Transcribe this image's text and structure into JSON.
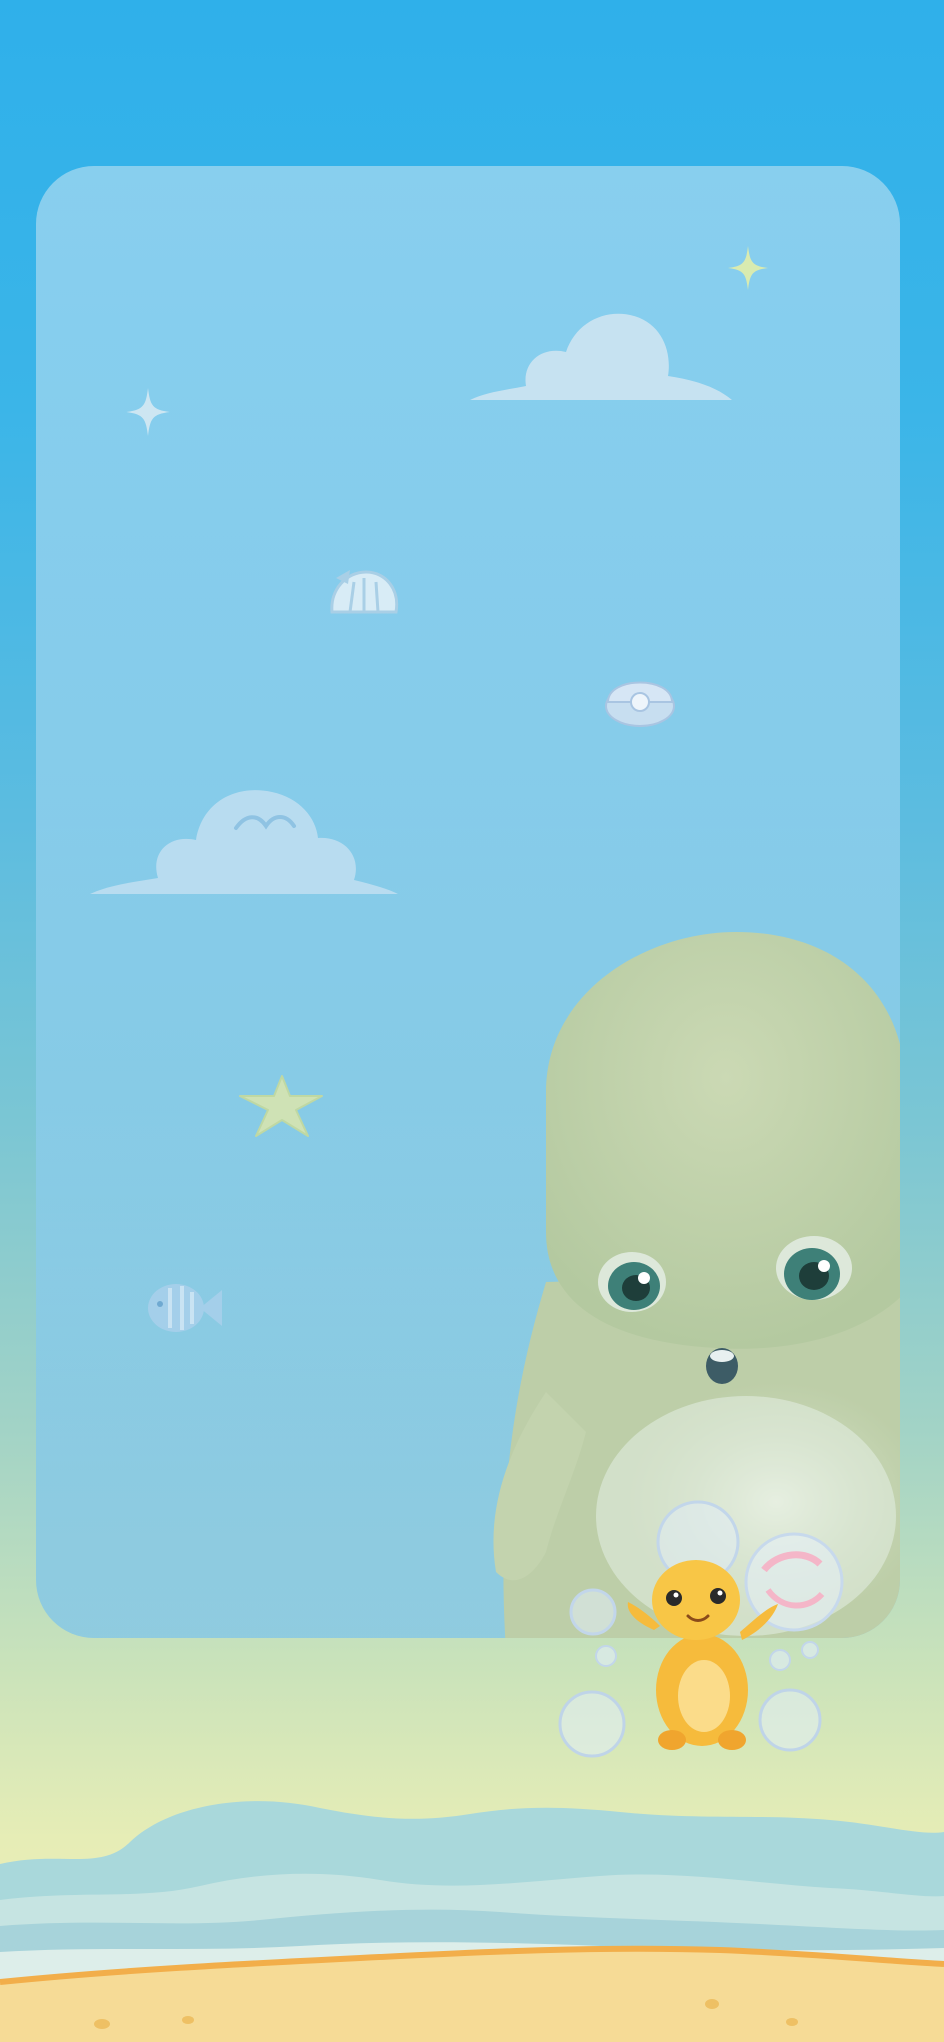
{
  "wallpaper": {
    "panel_color": "#9CD4EF",
    "sky_top": "#2FB0EA",
    "sand_color": "#F6DB96",
    "wave_color": "#A9D9DC",
    "elements": [
      "sparkle-icon",
      "cloud-icon",
      "shell-icon",
      "pearl-shell-icon",
      "starfish-icon",
      "fish-icon",
      "seal-character",
      "yellow-dino-character",
      "bubble-icon",
      "wave-pattern",
      "sand-beach"
    ]
  }
}
